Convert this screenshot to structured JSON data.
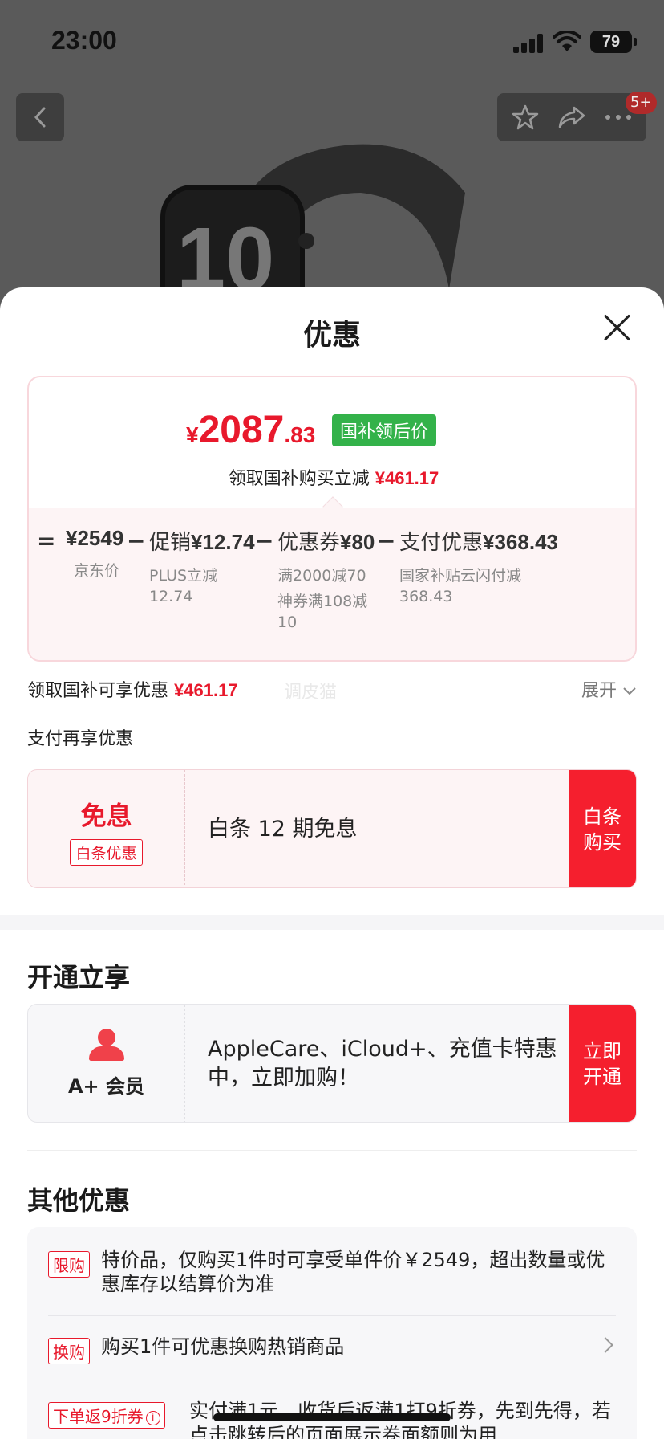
{
  "status_bar": {
    "time": "23:00",
    "battery": "79"
  },
  "background": {
    "badge": "5+",
    "watch_label": "10"
  },
  "sheet": {
    "title": "优惠",
    "final_price": {
      "currency": "¥",
      "integer": "2087",
      "decimal": ".83",
      "tag": "国补领后价"
    },
    "subsidy_line": {
      "text": "领取国补购买立减",
      "amount": "¥461.17"
    },
    "breakdown": {
      "equals": "=",
      "minus": "−",
      "items": [
        {
          "label": "",
          "value": "¥2549",
          "sub": [
            "京东价"
          ]
        },
        {
          "label": "促销",
          "value": "¥12.74",
          "sub": [
            "PLUS立减",
            "12.74"
          ]
        },
        {
          "label": "优惠券",
          "value": "¥80",
          "sub": [
            "满2000减70",
            "神券满108减",
            "10"
          ]
        },
        {
          "label": "支付优惠",
          "value": "¥368.43",
          "sub": [
            "国家补贴云闪付减",
            "368.43"
          ]
        }
      ]
    },
    "subsidy_row": {
      "text": "领取国补可享优惠",
      "amount": "¥461.17",
      "watermark": "调皮猫",
      "expand": "展开"
    },
    "pay_more": "支付再享优惠",
    "mianxi": {
      "title": "免息",
      "tag": "白条优惠",
      "text": "白条 12 期免息",
      "action_1": "白条",
      "action_2": "购买"
    },
    "open_section": {
      "title": "开通立享",
      "label": "A+ 会员",
      "text": "AppleCare、iCloud+、充值卡特惠中，立即加购！",
      "action_1": "立即",
      "action_2": "开通"
    },
    "other_section": {
      "title": "其他优惠",
      "rows": [
        {
          "tag": "限购",
          "text": "特价品，仅购买1件时可享受单件价￥2549，超出数量或优惠库存以结算价为准"
        },
        {
          "tag": "换购",
          "text": "购买1件可优惠换购热销商品"
        },
        {
          "tag": "下单返9折券",
          "text": "实付满1元，收货后返满1打9折券，先到先得，若点击跳转后的页面展示卷面额则为用"
        }
      ]
    }
  }
}
